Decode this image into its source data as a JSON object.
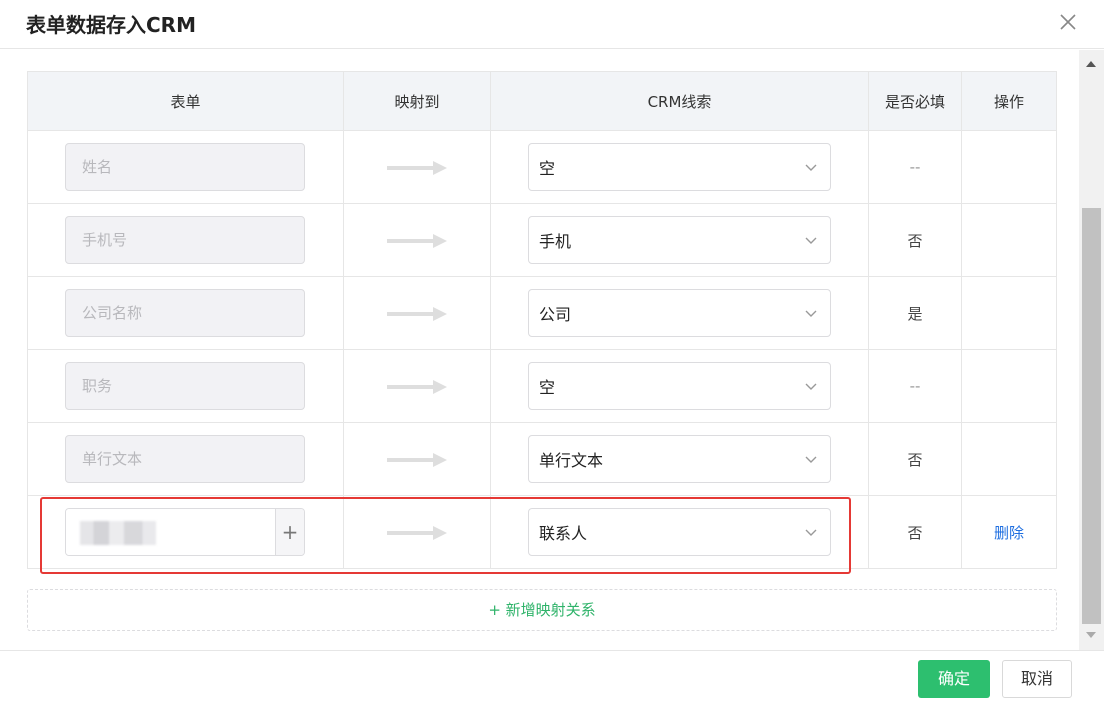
{
  "dialog": {
    "title": "表单数据存入CRM",
    "close_icon": "close-icon"
  },
  "table": {
    "headers": [
      "表单",
      "映射到",
      "CRM线索",
      "是否必填",
      "操作"
    ],
    "rows": [
      {
        "form_field": "姓名",
        "crm_field": "空",
        "required": "--",
        "action": ""
      },
      {
        "form_field": "手机号",
        "crm_field": "手机",
        "required": "否",
        "action": ""
      },
      {
        "form_field": "公司名称",
        "crm_field": "公司",
        "required": "是",
        "action": ""
      },
      {
        "form_field": "职务",
        "crm_field": "空",
        "required": "--",
        "action": ""
      },
      {
        "form_field": "单行文本",
        "crm_field": "单行文本",
        "required": "否",
        "action": ""
      },
      {
        "form_field": "",
        "crm_field": "联系人",
        "required": "否",
        "action": "删除",
        "add_button": "+"
      }
    ]
  },
  "add_mapping": "+ 新增映射关系",
  "footer": {
    "confirm_label": "确定",
    "cancel_label": "取消"
  },
  "colors": {
    "primary": "#2dbf6f",
    "link": "#1f6fe0",
    "highlight": "#e53935"
  }
}
